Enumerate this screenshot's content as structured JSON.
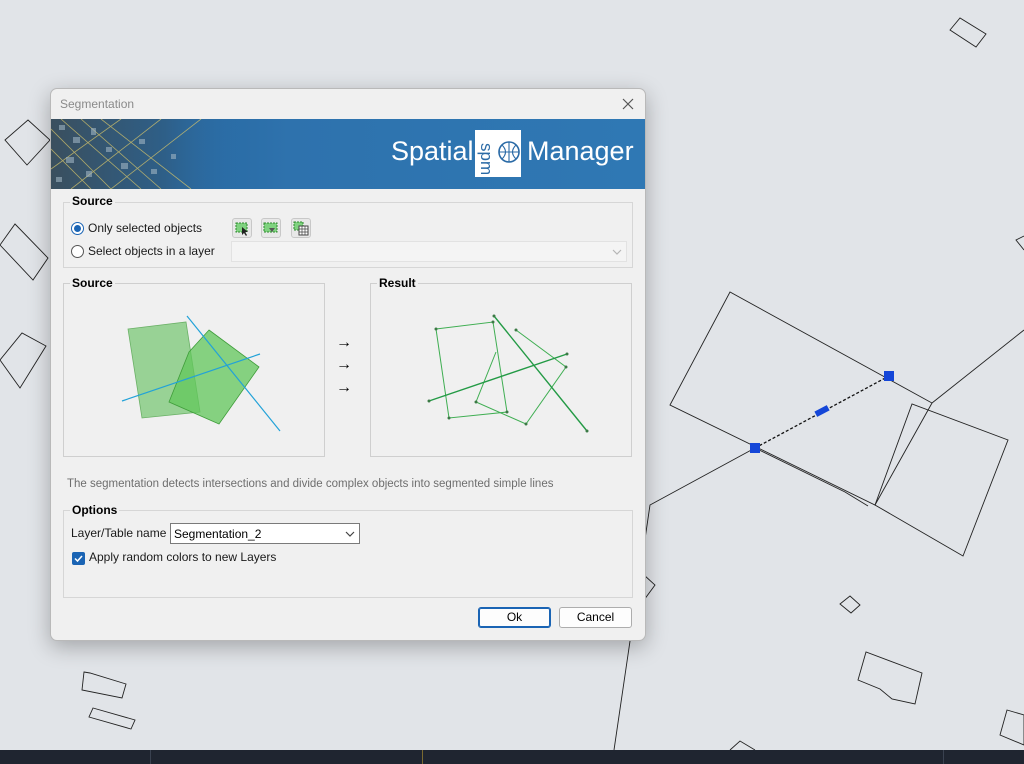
{
  "window": {
    "title": "Segmentation"
  },
  "banner": {
    "logo_left": "Spatial",
    "logo_mark": "spm",
    "logo_right": "Manager"
  },
  "source_group": {
    "title": "Source",
    "option_selected": "Only selected objects",
    "option_layer": "Select objects in a layer",
    "selected_option": "Only selected objects",
    "layer_combo_value": ""
  },
  "preview": {
    "source_title": "Source",
    "result_title": "Result",
    "arrows": [
      "→",
      "→",
      "→"
    ]
  },
  "description": "The segmentation detects intersections and divide complex objects into segmented simple lines",
  "options_group": {
    "title": "Options",
    "layer_label": "Layer/Table name",
    "layer_value": "Segmentation_2",
    "random_colors_label": "Apply random colors to new Layers",
    "random_colors_checked": true
  },
  "buttons": {
    "ok": "Ok",
    "cancel": "Cancel"
  },
  "colors": {
    "accent": "#1a64b4",
    "banner": "#2e72ad",
    "selection_grip": "#1446d8"
  },
  "icons": [
    "close-icon",
    "select-objects-icon",
    "select-by-attributes-icon",
    "select-table-icon",
    "chevron-down-icon",
    "checkmark-icon"
  ]
}
